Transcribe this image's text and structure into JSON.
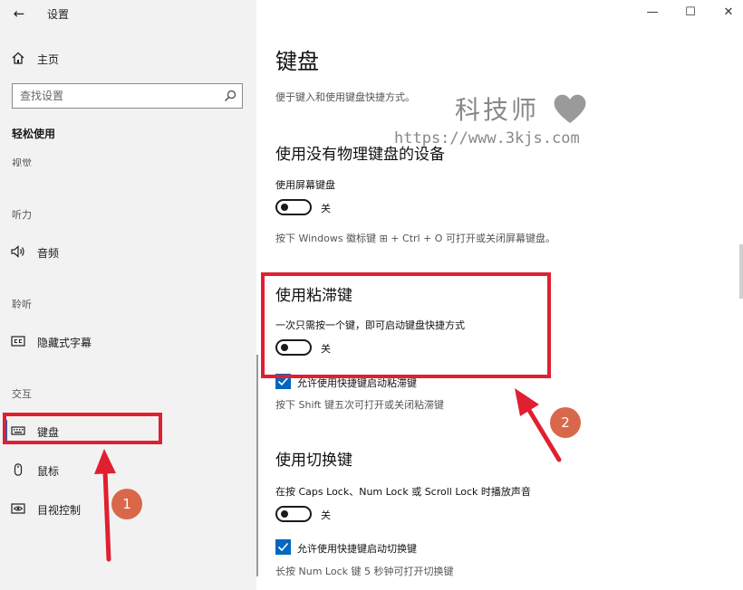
{
  "window": {
    "title": "设置",
    "controls": {
      "minimize": "—",
      "maximize": "☐",
      "close": "✕"
    }
  },
  "sidebar": {
    "home_label": "主页",
    "search_placeholder": "查找设置",
    "section_title": "轻松使用",
    "categories": {
      "vision": "视觉",
      "hearing": "听力",
      "listening": "聆听",
      "interaction": "交互"
    },
    "items": [
      {
        "label": "音频",
        "icon": "speaker-icon"
      },
      {
        "label": "隐藏式字幕",
        "icon": "closed-caption-icon"
      },
      {
        "label": "键盘",
        "icon": "keyboard-icon",
        "selected": true
      },
      {
        "label": "鼠标",
        "icon": "mouse-icon"
      },
      {
        "label": "目视控制",
        "icon": "eye-control-icon"
      }
    ]
  },
  "main": {
    "title": "键盘",
    "description": "便于键入和使用键盘快捷方式。",
    "onscreen": {
      "heading": "使用没有物理键盘的设备",
      "label": "使用屏幕键盘",
      "toggle_state": "关",
      "hint": "按下 Windows 徽标键 ⊞ + Ctrl + O 可打开或关闭屏幕键盘。"
    },
    "sticky": {
      "heading": "使用粘滞键",
      "label": "一次只需按一个键，即可启动键盘快捷方式",
      "toggle_state": "关",
      "checkbox_label": "允许使用快捷键启动粘滞键",
      "hint": "按下 Shift 键五次可打开或关闭粘滞键"
    },
    "toggle_keys": {
      "heading": "使用切换键",
      "label": "在按 Caps Lock、Num Lock 或 Scroll Lock 时播放声音",
      "toggle_state": "关",
      "checkbox_label": "允许使用快捷键启动切换键",
      "hint": "长按 Num Lock 键 5 秒钟可打开切换键"
    }
  },
  "watermark": {
    "name": "科技师",
    "url": "https://www.3kjs.com"
  },
  "annotations": {
    "badge_1": "1",
    "badge_2": "2",
    "color": "#e02030"
  },
  "colors": {
    "accent": "#0067c0",
    "sidebar_bg": "#f2f2f2",
    "badge": "#d9684a"
  }
}
